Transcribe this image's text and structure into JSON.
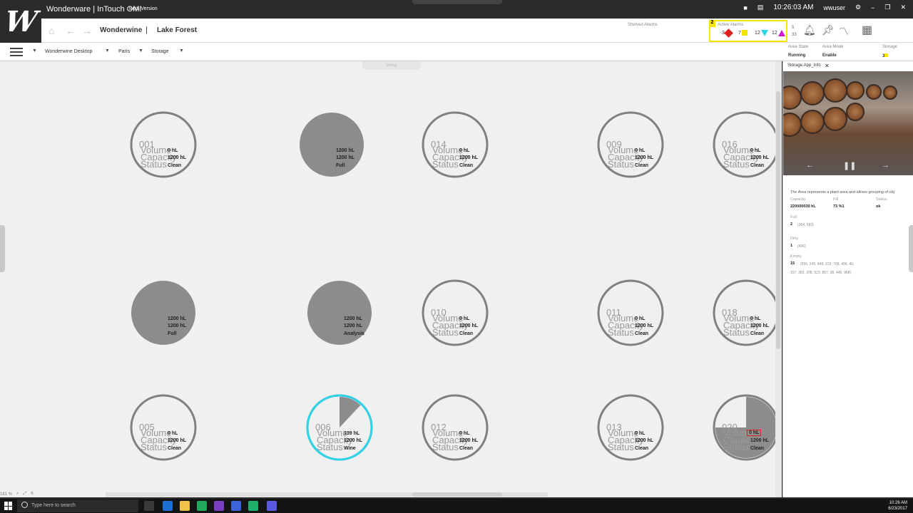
{
  "titlebar": {
    "title": "Wonderware | InTouch OMI",
    "beta": "Beta Version",
    "time": "10:26:03 AM",
    "user": "wwuser"
  },
  "header": {
    "breadcrumb_main": "Wonderwine",
    "separator": "|",
    "breadcrumb_sub": "Lake Forest",
    "shelved_label": "Shelved Alarms",
    "active_alarms_label": "Active Alarms",
    "active_badge": "2",
    "alarms": [
      {
        "count": "3",
        "shape": "red-diamond",
        "color": "#e02020"
      },
      {
        "count": "7",
        "shape": "yellow-square",
        "color": "#f3e500"
      },
      {
        "count": "12",
        "shape": "cyan-triangle-down",
        "color": "#2bd4e6"
      },
      {
        "count": "12",
        "shape": "magenta-triangle-up",
        "color": "#d41ad4"
      }
    ],
    "alarm_stat_top": "5",
    "alarm_stat_bottom": "33"
  },
  "subbar": {
    "items": [
      "Wonderwine Desktop",
      "Paris",
      "Storage"
    ],
    "area_state_label": "Area State",
    "area_state_value": "Running",
    "area_mode_label": "Area Mode",
    "area_mode_value": "Enable",
    "storage_label": "Storage",
    "storage_value": "3"
  },
  "canvas": {
    "top_tab": "Mixing",
    "zoom": "181 %"
  },
  "tanks": [
    {
      "id": "001",
      "vol": "0 hL",
      "cap": "1200 hL",
      "status": "Clean",
      "fill": 0
    },
    {
      "id": "",
      "vol": "1200 hL",
      "cap": "1200 hL",
      "status": "Full",
      "fill": 1
    },
    {
      "id": "014",
      "vol": "0 hL",
      "cap": "1200 hL",
      "status": "Clean",
      "fill": 0
    },
    {
      "id": "009",
      "vol": "0 hL",
      "cap": "1200 hL",
      "status": "Clean",
      "fill": 0
    },
    {
      "id": "016",
      "vol": "0 hL",
      "cap": "1200 hL",
      "status": "Clean",
      "fill": 0
    },
    {
      "id": "",
      "vol": "1200 hL",
      "cap": "1200 hL",
      "status": "Full",
      "fill": 1
    },
    {
      "id": "",
      "vol": "1200 hL",
      "cap": "1200 hL",
      "status": "Analysis",
      "fill": 1
    },
    {
      "id": "010",
      "vol": "0 hL",
      "cap": "1200 hL",
      "status": "Clean",
      "fill": 0
    },
    {
      "id": "011",
      "vol": "0 hL",
      "cap": "1200 hL",
      "status": "Clean",
      "fill": 0
    },
    {
      "id": "018",
      "vol": "0 hL",
      "cap": "1200 hL",
      "status": "Clean",
      "fill": 0
    },
    {
      "id": "005",
      "vol": "0 hL",
      "cap": "1200 hL",
      "status": "Clean",
      "fill": 0
    },
    {
      "id": "006",
      "vol": "139 hL",
      "cap": "1200 hL",
      "status": "Wine",
      "fill": 0.12
    },
    {
      "id": "012",
      "vol": "0 hL",
      "cap": "1200 hL",
      "status": "Clean",
      "fill": 0
    },
    {
      "id": "013",
      "vol": "0 hL",
      "cap": "1200 hL",
      "status": "Clean",
      "fill": 0
    },
    {
      "id": "020",
      "vol": "0 hL",
      "cap": "1200 hL",
      "status": "Clean",
      "fill": 0.75
    }
  ],
  "tank_labels": {
    "volume": "Volume",
    "capacity": "Capacity",
    "status": "Status"
  },
  "panel": {
    "tab_label": "Storage.App_Info",
    "description": "The Area represents a plant area and allows grouping of obj",
    "capacity_label": "Capacity",
    "capacity_value": "220000039 hL",
    "fill_label": "Fill",
    "fill_value": "73 %1",
    "status_label": "Status",
    "status_value": "ok",
    "full_label": "Full",
    "full_count": "2",
    "full_list": "(364, 583)",
    "dirty_label": "Dirty",
    "dirty_count": "1",
    "dirty_list": "(406)",
    "empty_label": "Empty",
    "empty_count": "15",
    "empty_list_1": "(655, 245, 848, 315, 708, 406, 49,",
    "empty_list_2": "157, 363, 208, 523, 857, 38, 446, 968)"
  },
  "taskbar": {
    "search_placeholder": "Type here to search",
    "time": "10:26 AM",
    "date": "6/23/2017"
  },
  "colors": {
    "selected_ring": "#2bd4e6",
    "alarm_highlight": "#f5e500",
    "tank_fill": "#8c8c8c"
  }
}
